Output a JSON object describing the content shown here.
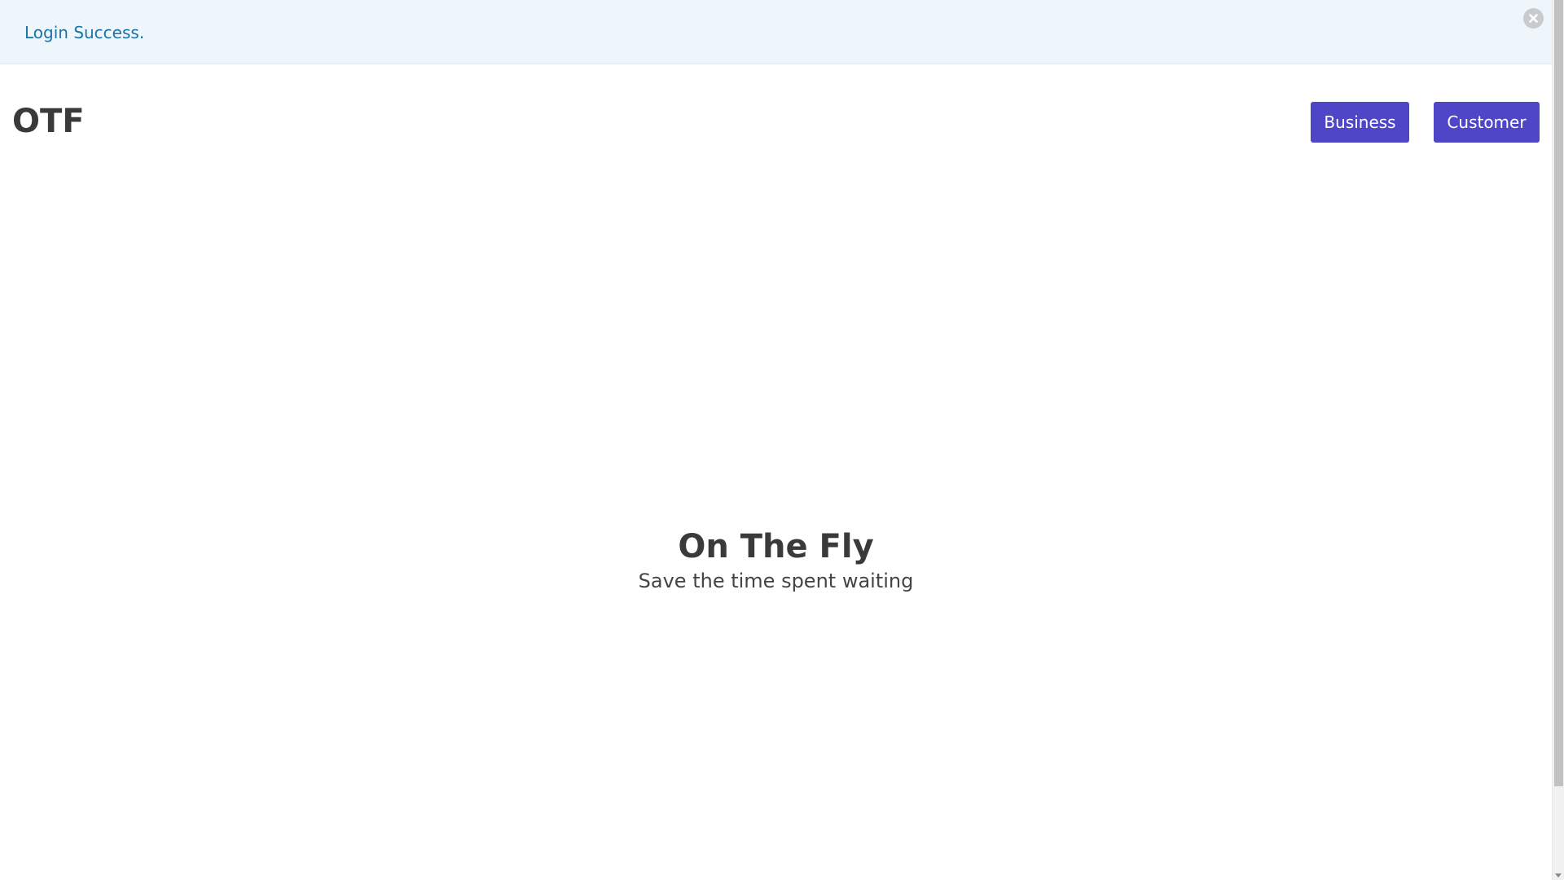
{
  "alert": {
    "message": "Login Success.",
    "close_icon": "close-circle-icon"
  },
  "header": {
    "brand": "OTF",
    "nav": {
      "business_label": "Business",
      "customer_label": "Customer"
    }
  },
  "hero": {
    "title": "On The Fly",
    "subtitle": "Save the time spent waiting"
  },
  "colors": {
    "accent": "#4f46c7",
    "alert_bg": "#eef5fb",
    "alert_text": "#1a73a8",
    "heading": "#3a3a3a"
  }
}
